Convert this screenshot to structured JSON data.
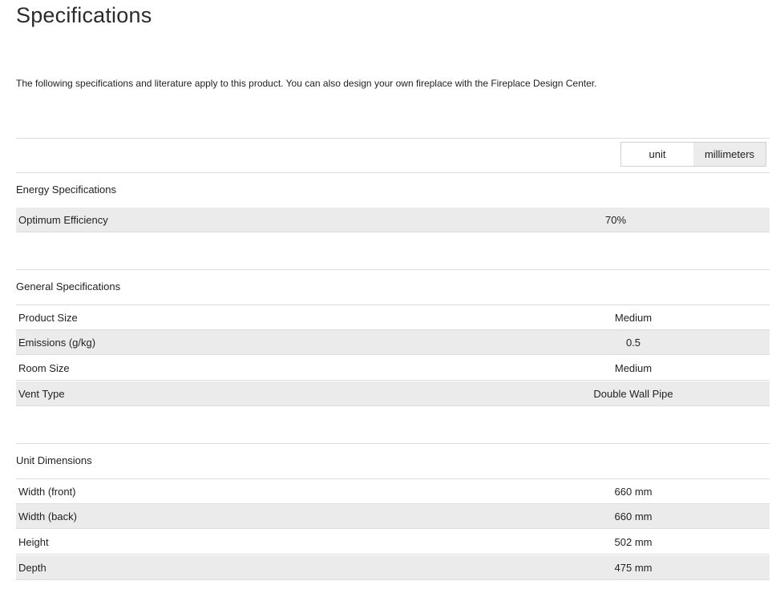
{
  "page": {
    "title": "Specifications",
    "intro": "The following specifications and literature apply to this product. You can also design your own fireplace with the Fireplace Design Center."
  },
  "unit_toggle": {
    "options": [
      "unit",
      "millimeters"
    ],
    "selected": "millimeters"
  },
  "energy": {
    "title": "Energy Specifications",
    "rows": [
      {
        "label": "Optimum Efficiency",
        "value": "70%"
      }
    ]
  },
  "general": {
    "title": "General Specifications",
    "rows": [
      {
        "label": "Product Size",
        "value": "Medium"
      },
      {
        "label": "Emissions (g/kg)",
        "value": "0.5"
      },
      {
        "label": "Room Size",
        "value": "Medium"
      },
      {
        "label": "Vent Type",
        "value": "Double Wall Pipe"
      }
    ]
  },
  "dimensions": {
    "title": "Unit Dimensions",
    "rows": [
      {
        "label": "Width (front)",
        "value": "660 mm"
      },
      {
        "label": "Width (back)",
        "value": "660 mm"
      },
      {
        "label": "Height",
        "value": "502 mm"
      },
      {
        "label": "Depth",
        "value": "475 mm"
      }
    ]
  }
}
